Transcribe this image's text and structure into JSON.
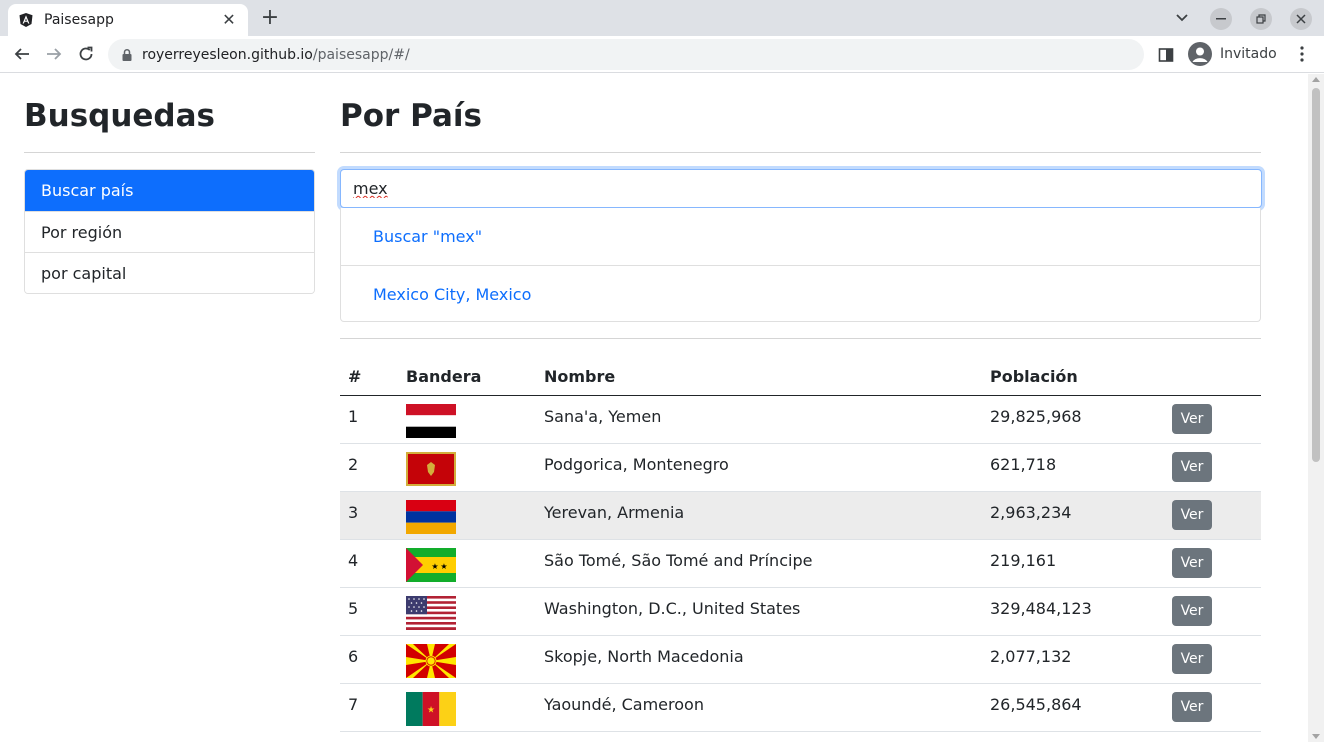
{
  "browser": {
    "tab_title": "Paisesapp",
    "url_host": "royerreyesleon.github.io",
    "url_path": "/paisesapp/#/",
    "profile_name": "Invitado"
  },
  "sidebar": {
    "title": "Busquedas",
    "items": [
      {
        "label": "Buscar país",
        "active": true
      },
      {
        "label": "Por región",
        "active": false
      },
      {
        "label": "por capital",
        "active": false
      }
    ]
  },
  "main": {
    "title": "Por País",
    "search_value": "mex",
    "suggestions": [
      "Buscar \"mex\"",
      "Mexico City, Mexico"
    ],
    "table": {
      "headers": [
        "#",
        "Bandera",
        "Nombre",
        "Población",
        ""
      ],
      "button_label": "Ver",
      "rows": [
        {
          "num": "1",
          "flag": "yemen",
          "name": "Sana'a, Yemen",
          "population": "29,825,968"
        },
        {
          "num": "2",
          "flag": "montenegro",
          "name": "Podgorica, Montenegro",
          "population": "621,718"
        },
        {
          "num": "3",
          "flag": "armenia",
          "name": "Yerevan, Armenia",
          "population": "2,963,234"
        },
        {
          "num": "4",
          "flag": "sao-tome",
          "name": "São Tomé, São Tomé and Príncipe",
          "population": "219,161"
        },
        {
          "num": "5",
          "flag": "usa",
          "name": "Washington, D.C., United States",
          "population": "329,484,123"
        },
        {
          "num": "6",
          "flag": "north-macedonia",
          "name": "Skopje, North Macedonia",
          "population": "2,077,132"
        },
        {
          "num": "7",
          "flag": "cameroon",
          "name": "Yaoundé, Cameroon",
          "population": "26,545,864"
        }
      ]
    }
  },
  "colors": {
    "primary": "#0d6efd",
    "secondary_button": "#6c757d",
    "highlight_row": "#ececec"
  }
}
